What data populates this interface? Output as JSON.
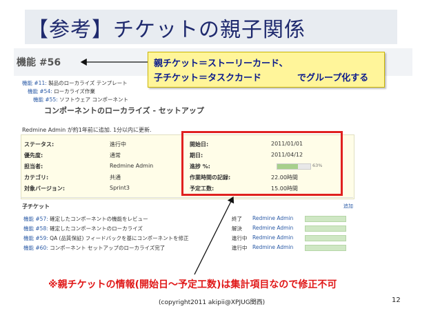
{
  "slide": {
    "title": "【参考】チケットの親子関係",
    "note": "※親チケットの情報(開始日～予定工数)は集計項目なので修正不可",
    "footer": "(copyright2011 akipii@XPJUG関西)",
    "page_number": "12"
  },
  "callout": {
    "line1": "親チケット＝ストーリーカード、",
    "line2": "子チケット＝タスクカード",
    "line3": "でグループ化する"
  },
  "issue": {
    "header": "機能 #56",
    "breadcrumb": [
      {
        "link": "機能 #11:",
        "text": "製品のローカライズ テンプレート"
      },
      {
        "link": "機能 #54:",
        "text": "ローカライズ作業"
      },
      {
        "link": "機能 #55:",
        "text": "ソフトウェア コンポーネント"
      }
    ],
    "subject": "コンポーネントのローカライズ - セットアップ",
    "author_line": "Redmine Admin が約1年前に追加. 1分以内に更新.",
    "left_attrs": [
      {
        "label": "ステータス:",
        "value": "進行中"
      },
      {
        "label": "優先度:",
        "value": "通常"
      },
      {
        "label": "担当者:",
        "value": "Redmine Admin"
      },
      {
        "label": "カテゴリ:",
        "value": "共通"
      },
      {
        "label": "対象バージョン:",
        "value": "Sprint3"
      }
    ],
    "right_attrs": [
      {
        "label": "開始日:",
        "value": "2011/01/01"
      },
      {
        "label": "期日:",
        "value": "2011/04/12"
      },
      {
        "label": "進捗 %:",
        "value": "63%"
      },
      {
        "label": "作業時間の記録:",
        "value": "22.00時間"
      },
      {
        "label": "予定工数:",
        "value": "15.00時間"
      }
    ],
    "progress_fraction": 0.63,
    "subtasks_title": "子チケット",
    "add_label": "追加",
    "subtasks": [
      {
        "id": "機能 #57:",
        "title": "確定したコンポーネントの機能をレビュー",
        "status": "終了",
        "assignee": "Redmine Admin"
      },
      {
        "id": "機能 #58:",
        "title": "確定したコンポーネントのローカライズ",
        "status": "解決",
        "assignee": "Redmine Admin"
      },
      {
        "id": "機能 #59:",
        "title": "QA (品質保証) フィードバックを基にコンポーネントを修正",
        "status": "進行中",
        "assignee": "Redmine Admin"
      },
      {
        "id": "機能 #60:",
        "title": "コンポーネント セットアップのローカライズ完了",
        "status": "進行中",
        "assignee": "Redmine Admin"
      }
    ]
  },
  "colors": {
    "title_bg": "#e8ecf1",
    "callout_bg": "#fff59a",
    "highlight_border": "#e02020",
    "note_text": "#e01818"
  }
}
